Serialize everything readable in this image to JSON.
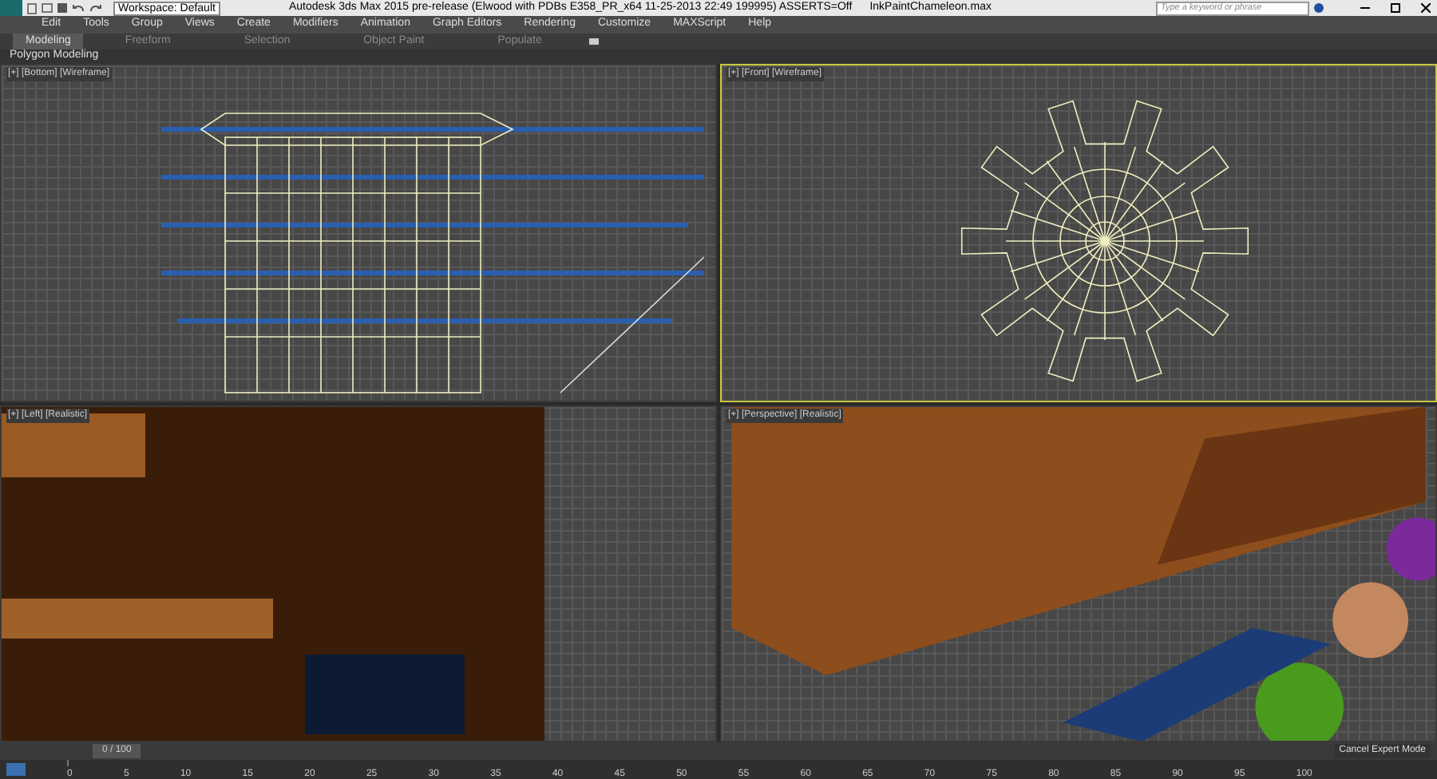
{
  "title_bar": {
    "workspace": "Workspace: Default",
    "title": "Autodesk 3ds Max  2015 pre-release (Elwood with PDBs E358_PR_x64 11-25-2013 22:49 199995) ASSERTS=Off",
    "file": "InkPaintChameleon.max",
    "search": {
      "placeholder": "Type a keyword or phrase"
    }
  },
  "menu": [
    "Edit",
    "Tools",
    "Group",
    "Views",
    "Create",
    "Modifiers",
    "Animation",
    "Graph Editors",
    "Rendering",
    "Customize",
    "MAXScript",
    "Help"
  ],
  "ribbon_tabs": [
    {
      "label": "Modeling",
      "selected": true
    },
    {
      "label": "Freeform",
      "selected": false
    },
    {
      "label": "Selection",
      "selected": false
    },
    {
      "label": "Object Paint",
      "selected": false
    },
    {
      "label": "Populate",
      "selected": false
    }
  ],
  "ribbon_panel": "Polygon Modeling",
  "viewports": [
    {
      "label": "[+] [Bottom] [Wireframe]",
      "kind": "bottom",
      "active": false
    },
    {
      "label": "[+] [Front] [Wireframe]",
      "kind": "front",
      "active": true
    },
    {
      "label": "[+] [Left] [Realistic]",
      "kind": "left",
      "active": false
    },
    {
      "label": "[+] [Perspective] [Realistic]",
      "kind": "perspective",
      "active": false
    }
  ],
  "time_slider": {
    "frame": "0 / 100",
    "ticks": [
      "0",
      "5",
      "10",
      "15",
      "20",
      "25",
      "30",
      "35",
      "40",
      "45",
      "50",
      "55",
      "60",
      "65",
      "70",
      "75",
      "80",
      "85",
      "90",
      "95",
      "100"
    ]
  },
  "status": {
    "button": "Cancel Expert Mode"
  }
}
